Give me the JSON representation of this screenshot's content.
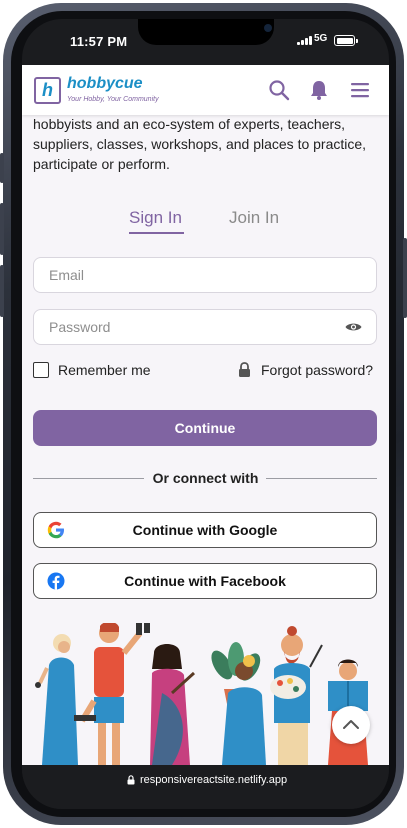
{
  "status": {
    "time": "11:57 PM",
    "network": "5G"
  },
  "header": {
    "logo_letter": "h",
    "logo_name": "hobbycue",
    "logo_tagline": "Your Hobby, Your Community"
  },
  "intro_text": "hobbyists and an eco-system of experts, teachers, suppliers, classes, workshops, and places to practice, participate or perform.",
  "tabs": [
    {
      "label": "Sign In",
      "active": true
    },
    {
      "label": "Join In",
      "active": false
    }
  ],
  "form": {
    "email_placeholder": "Email",
    "password_placeholder": "Password",
    "remember_label": "Remember me",
    "forgot_label": "Forgot password?",
    "continue_label": "Continue",
    "divider_label": "Or connect with",
    "google_label": "Continue with Google",
    "facebook_label": "Continue with Facebook"
  },
  "browser": {
    "url": "responsivereactsite.netlify.app"
  },
  "colors": {
    "accent": "#8064a2",
    "logo_blue": "#1c8fc6",
    "background": "#f7f5f9"
  }
}
